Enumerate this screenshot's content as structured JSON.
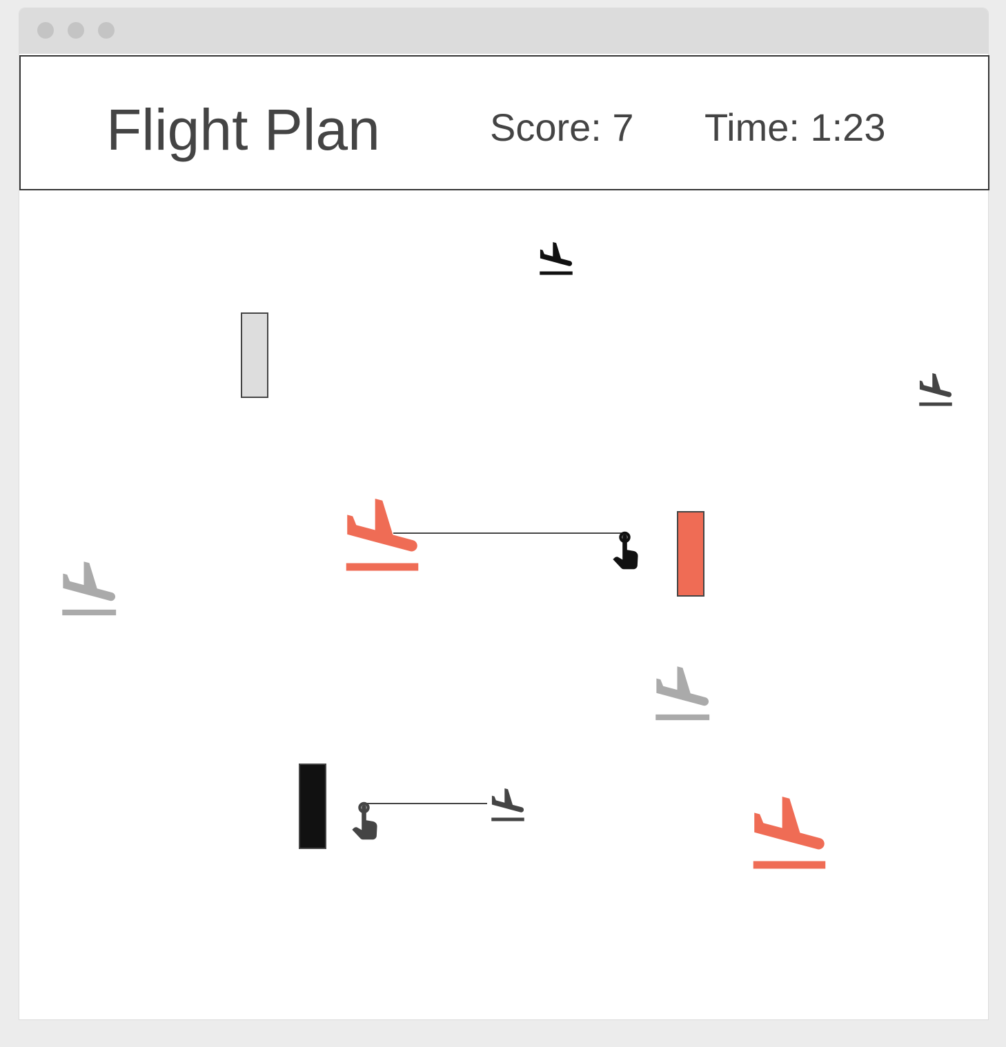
{
  "header": {
    "title": "Flight Plan",
    "score_label": "Score: 7",
    "time_label": "Time: 1:23"
  },
  "colors": {
    "accent": "#ef6c55",
    "dark": "#111111",
    "mid": "#444444",
    "muted": "#aaaaaa",
    "light": "#dddddd",
    "text": "#444444"
  },
  "icons": {
    "plane": "flight-land-icon",
    "runway": "runway-block",
    "cursor": "touch-hand-icon"
  }
}
